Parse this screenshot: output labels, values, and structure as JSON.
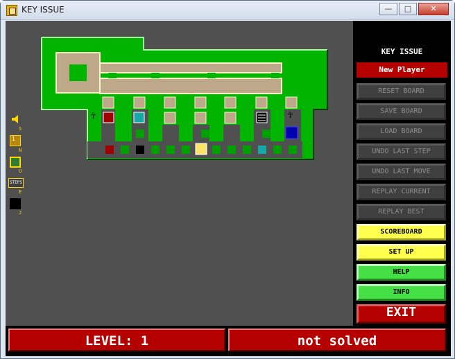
{
  "window": {
    "title": "KEY ISSUE",
    "controls": {
      "minimize": "—",
      "maximize": "□",
      "close": "✕"
    }
  },
  "panel": {
    "title": "KEY ISSUE",
    "player": "New Player",
    "buttons": [
      {
        "label": "RESET BOARD",
        "style": "disabled"
      },
      {
        "label": "SAVE BOARD",
        "style": "disabled"
      },
      {
        "label": "LOAD BOARD",
        "style": "disabled"
      },
      {
        "label": "UNDO LAST STEP",
        "style": "disabled"
      },
      {
        "label": "UNDO LAST MOVE",
        "style": "disabled"
      },
      {
        "label": "REPLAY CURRENT",
        "style": "disabled"
      },
      {
        "label": "REPLAY BEST",
        "style": "disabled"
      },
      {
        "label": "SCOREBOARD",
        "style": "yellow"
      },
      {
        "label": "SET UP",
        "style": "yellow"
      },
      {
        "label": "HELP",
        "style": "green"
      },
      {
        "label": "INFO",
        "style": "green"
      },
      {
        "label": "EXIT",
        "style": "red"
      }
    ]
  },
  "side_tools": {
    "sound": {
      "icon": "speaker-icon",
      "key": "S"
    },
    "numbers": {
      "icon": "number-toggle-icon",
      "value": "1",
      "key": "N"
    },
    "undo": {
      "icon": "undo-toggle-icon",
      "key": "U"
    },
    "steps": {
      "icon": "steps-icon",
      "label": "STEPS",
      "key": "E"
    },
    "jump": {
      "icon": "black-square-icon",
      "key": "J"
    }
  },
  "status": {
    "level": "LEVEL: 1",
    "state": "not solved"
  },
  "colors": {
    "wall": "#00b400",
    "floor": "#bda98a",
    "red_piece": "#a00000",
    "cyan_piece": "#18a8a8",
    "blue_piece": "#0000b0",
    "yellow_piece": "#ffe36a",
    "black_piece": "#000000",
    "green_piece": "#00a000"
  }
}
